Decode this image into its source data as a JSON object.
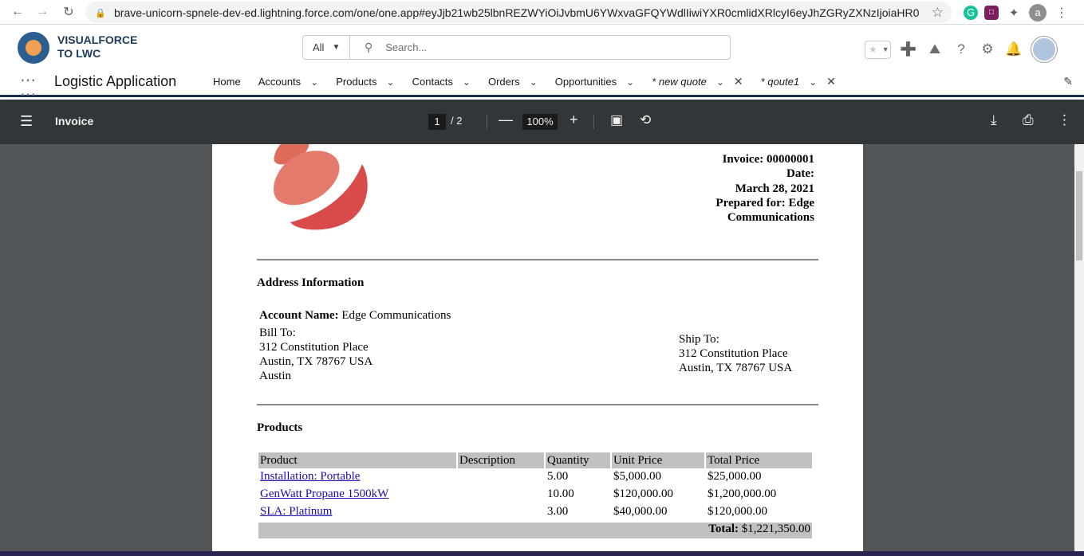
{
  "browser": {
    "url": "brave-unicorn-spnele-dev-ed.lightning.force.com/one/one.app#eyJjb21wb25lbnREZWYiOiJvbmU6YWxvaGFQYWdlIiwiYXR0cmlidXRlcyI6eyJhZGRyZXNzIjoiaHR0cH...",
    "profile_initial": "a"
  },
  "sf": {
    "brand_line1": "VISUALFORCE",
    "brand_line2": "TO LWC",
    "search_scope": "All",
    "search_placeholder": "Search...",
    "app_name": "Logistic Application",
    "nav": [
      {
        "label": "Home"
      },
      {
        "label": "Accounts"
      },
      {
        "label": "Products"
      },
      {
        "label": "Contacts"
      },
      {
        "label": "Orders"
      },
      {
        "label": "Opportunities"
      },
      {
        "label": "* new quote"
      },
      {
        "label": "* qoute1"
      }
    ]
  },
  "pdf": {
    "title": "Invoice",
    "current_page": "1",
    "total_pages": "/  2",
    "zoom": "100%"
  },
  "invoice": {
    "line1": "Invoice: 00000001",
    "line2": "Date:",
    "line3": "March 28, 2021",
    "line4": "Prepared for: Edge",
    "line5": "Communications",
    "address_title": "Address Information",
    "account_label": "Account Name:",
    "account_name": "Edge Communications",
    "bill_to_label": "Bill To:",
    "bill_street": "312 Constitution Place",
    "bill_city": "Austin, TX 78767 USA",
    "bill_extra": "Austin",
    "ship_to_label": "Ship To:",
    "ship_street": "312 Constitution Place",
    "ship_city": "Austin, TX 78767 USA",
    "products_title": "Products",
    "columns": [
      "Product",
      "Description",
      "Quantity",
      "Unit Price",
      "Total Price"
    ],
    "rows": [
      {
        "product": "Installation: Portable",
        "description": "",
        "quantity": "5.00",
        "unit_price": "$5,000.00",
        "total_price": "$25,000.00"
      },
      {
        "product": "GenWatt Propane 1500kW",
        "description": "",
        "quantity": "10.00",
        "unit_price": "$120,000.00",
        "total_price": "$1,200,000.00"
      },
      {
        "product": "SLA: Platinum",
        "description": "",
        "quantity": "3.00",
        "unit_price": "$40,000.00",
        "total_price": "$120,000.00"
      }
    ],
    "total_label": "Total:",
    "total_value": "$1,221,350.00"
  }
}
